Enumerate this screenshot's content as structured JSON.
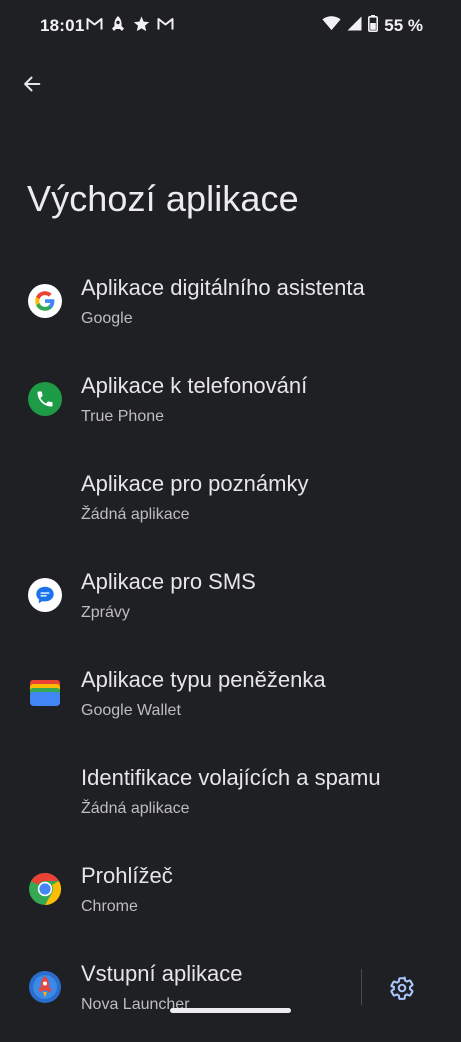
{
  "status_bar": {
    "time": "18:01",
    "battery_percent": "55 %"
  },
  "page": {
    "title": "Výchozí aplikace"
  },
  "items": [
    {
      "title": "Aplikace digitálního asistenta",
      "subtitle": "Google",
      "icon": "google-icon"
    },
    {
      "title": "Aplikace k telefonování",
      "subtitle": "True Phone",
      "icon": "phone-icon"
    },
    {
      "title": "Aplikace pro poznámky",
      "subtitle": "Žádná aplikace",
      "icon": null
    },
    {
      "title": "Aplikace pro SMS",
      "subtitle": "Zprávy",
      "icon": "messages-icon"
    },
    {
      "title": "Aplikace typu peněženka",
      "subtitle": "Google Wallet",
      "icon": "wallet-icon"
    },
    {
      "title": "Identifikace volajících a spamu",
      "subtitle": "Žádná aplikace",
      "icon": null
    },
    {
      "title": "Prohlížeč",
      "subtitle": "Chrome",
      "icon": "chrome-icon"
    },
    {
      "title": "Vstupní aplikace",
      "subtitle": "Nova Launcher",
      "icon": "nova-launcher-icon"
    }
  ],
  "colors": {
    "background": "#1f2023",
    "accent": "#a8c7fa",
    "phone_green": "#1e9b46",
    "messages_blue": "#1a73e8"
  }
}
